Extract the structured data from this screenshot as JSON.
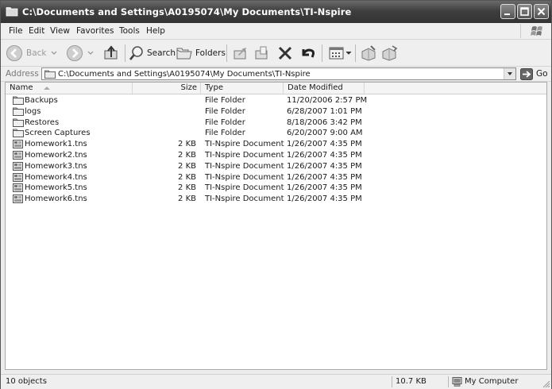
{
  "window": {
    "title": "C:\\Documents and Settings\\A0195074\\My Documents\\TI-Nspire",
    "controls": [
      "minimize-icon",
      "maximize-icon",
      "close-icon"
    ]
  },
  "menu": [
    "File",
    "Edit",
    "View",
    "Favorites",
    "Tools",
    "Help"
  ],
  "toolbar": {
    "back_label": "Back",
    "search_label": "Search",
    "folders_label": "Folders",
    "icons": [
      "back-icon",
      "forward-icon",
      "up-folder-icon",
      "search-icon",
      "folders-icon",
      "move-to-icon",
      "copy-to-icon",
      "delete-icon",
      "undo-icon",
      "views-icon",
      "properties-icon",
      "folder-options-icon"
    ]
  },
  "address": {
    "label": "Address",
    "value": "C:\\Documents and Settings\\A0195074\\My Documents\\TI-Nspire",
    "go_label": "Go"
  },
  "columns": {
    "name": "Name",
    "size": "Size",
    "type": "Type",
    "date": "Date Modified"
  },
  "files": [
    {
      "name": "Backups",
      "size": "",
      "type": "File Folder",
      "date": "11/20/2006 2:57 PM",
      "icon": "folder-icon"
    },
    {
      "name": "logs",
      "size": "",
      "type": "File Folder",
      "date": "6/28/2007 1:01 PM",
      "icon": "folder-icon"
    },
    {
      "name": "Restores",
      "size": "",
      "type": "File Folder",
      "date": "8/18/2006 3:42 PM",
      "icon": "folder-icon"
    },
    {
      "name": "Screen Captures",
      "size": "",
      "type": "File Folder",
      "date": "6/20/2007 9:00 AM",
      "icon": "folder-icon"
    },
    {
      "name": "Homework1.tns",
      "size": "2 KB",
      "type": "TI-Nspire Document",
      "date": "1/26/2007 4:35 PM",
      "icon": "tns-document-icon"
    },
    {
      "name": "Homework2.tns",
      "size": "2 KB",
      "type": "TI-Nspire Document",
      "date": "1/26/2007 4:35 PM",
      "icon": "tns-document-icon"
    },
    {
      "name": "Homework3.tns",
      "size": "2 KB",
      "type": "TI-Nspire Document",
      "date": "1/26/2007 4:35 PM",
      "icon": "tns-document-icon"
    },
    {
      "name": "Homework4.tns",
      "size": "2 KB",
      "type": "TI-Nspire Document",
      "date": "1/26/2007 4:35 PM",
      "icon": "tns-document-icon"
    },
    {
      "name": "Homework5.tns",
      "size": "2 KB",
      "type": "TI-Nspire Document",
      "date": "1/26/2007 4:35 PM",
      "icon": "tns-document-icon"
    },
    {
      "name": "Homework6.tns",
      "size": "2 KB",
      "type": "TI-Nspire Document",
      "date": "1/26/2007 4:35 PM",
      "icon": "tns-document-icon"
    }
  ],
  "status": {
    "count": "10 objects",
    "size": "10.7 KB",
    "location": "My Computer"
  },
  "colors": {
    "titlebar": "#3f3f3f",
    "chrome": "#efefef"
  }
}
